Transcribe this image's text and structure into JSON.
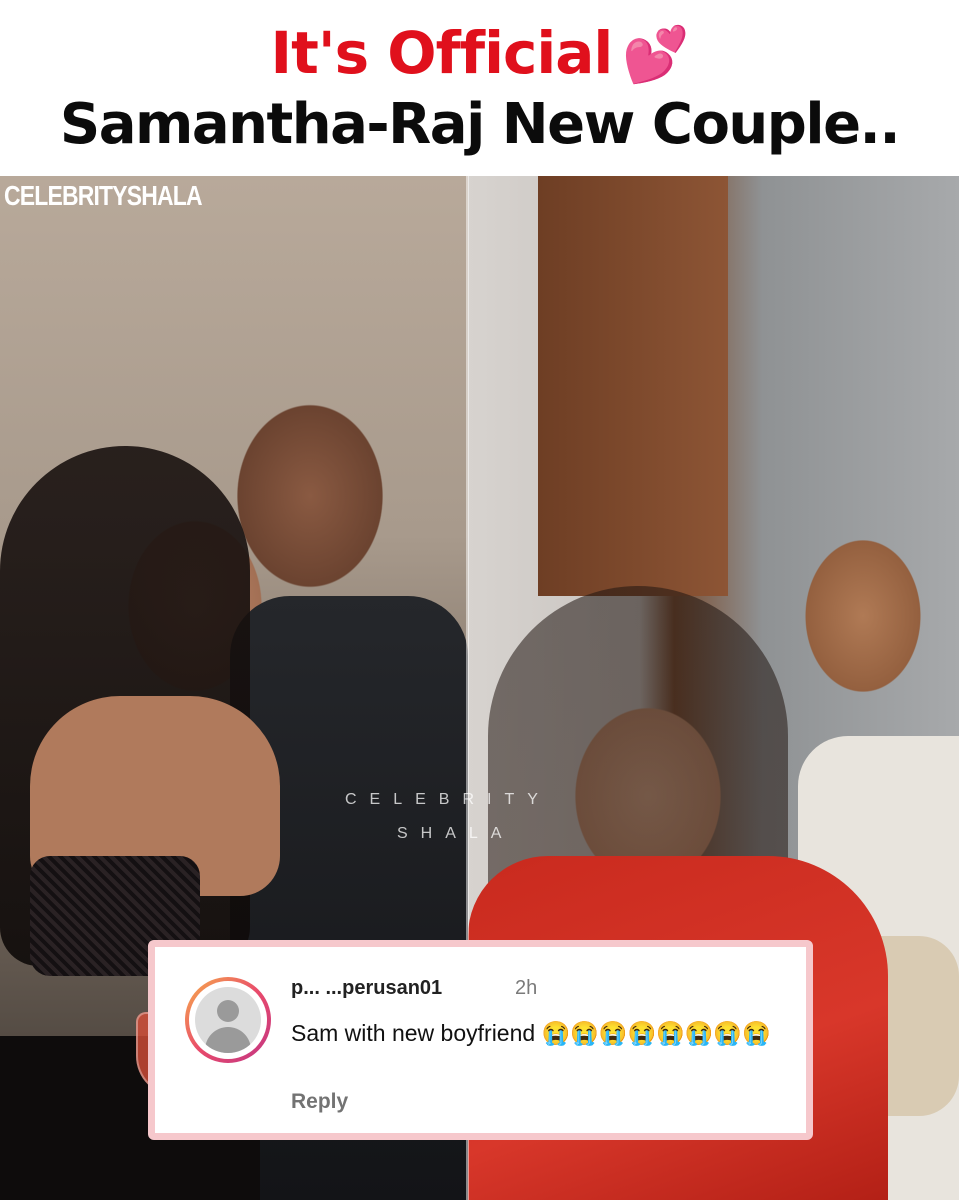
{
  "header": {
    "headline_line1": "It's Official",
    "headline_emoji": "💕",
    "headline_line2": "Samantha-Raj New Couple.."
  },
  "photos": {
    "brand_text": "CELEBRITYSHALA",
    "watermark_line1": "CELEBRITY",
    "watermark_line2": "SHALA"
  },
  "comment": {
    "username": "p... ...perusan01",
    "time": "2h",
    "text": "Sam with new boyfriend 😭😭😭😭😭😭😭😭",
    "reply_label": "Reply"
  },
  "colors": {
    "headline_red": "#e0101c",
    "card_border": "#f6c8cc"
  }
}
